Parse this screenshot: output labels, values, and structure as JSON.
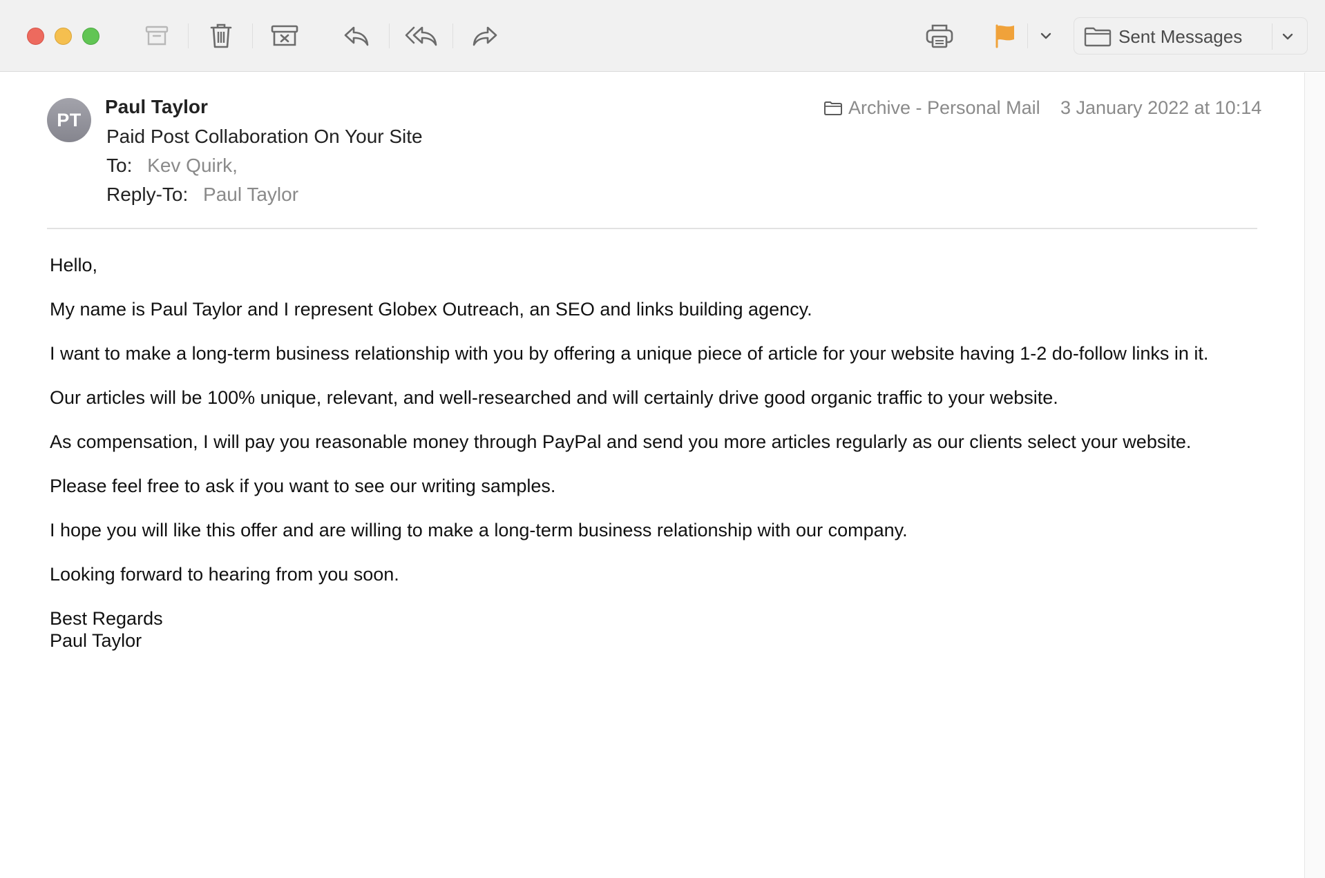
{
  "toolbar": {
    "mailbox_selected": "Sent Messages",
    "flag_color": "#f0a23a",
    "icons": [
      "archive-icon",
      "trash-icon",
      "junk-icon",
      "reply-icon",
      "reply-all-icon",
      "forward-icon",
      "print-icon",
      "flag-icon",
      "chevron-down-icon",
      "folder-icon"
    ]
  },
  "message": {
    "avatar_initials": "PT",
    "sender": "Paul Taylor",
    "subject": "Paid Post Collaboration On Your Site",
    "to_label": "To:",
    "to_value": "Kev Quirk,",
    "reply_to_label": "Reply-To:",
    "reply_to_value": "Paul Taylor",
    "mailbox": "Archive - Personal Mail",
    "date": "3 January 2022 at 10:14"
  },
  "body": {
    "greeting": "Hello,",
    "p1": "My name is Paul Taylor and I represent Globex Outreach, an SEO and links building agency.",
    "p2": "I want to make a long-term business relationship with you by offering a unique piece of article for your website having 1-2 do-follow links in it.",
    "p3": "Our articles will be 100% unique, relevant, and well-researched and will certainly drive good organic traffic to your website.",
    "p4": "As compensation, I will pay you reasonable money through PayPal and send you more articles regularly as our clients select your website.",
    "p5": "Please feel free to ask if you want to see our writing samples.",
    "p6": "I hope you will like this offer and are willing to make a long-term business relationship with our company.",
    "p7": "Looking forward to hearing from you soon.",
    "sign_off": "Best Regards",
    "signature_name": "Paul Taylor"
  }
}
